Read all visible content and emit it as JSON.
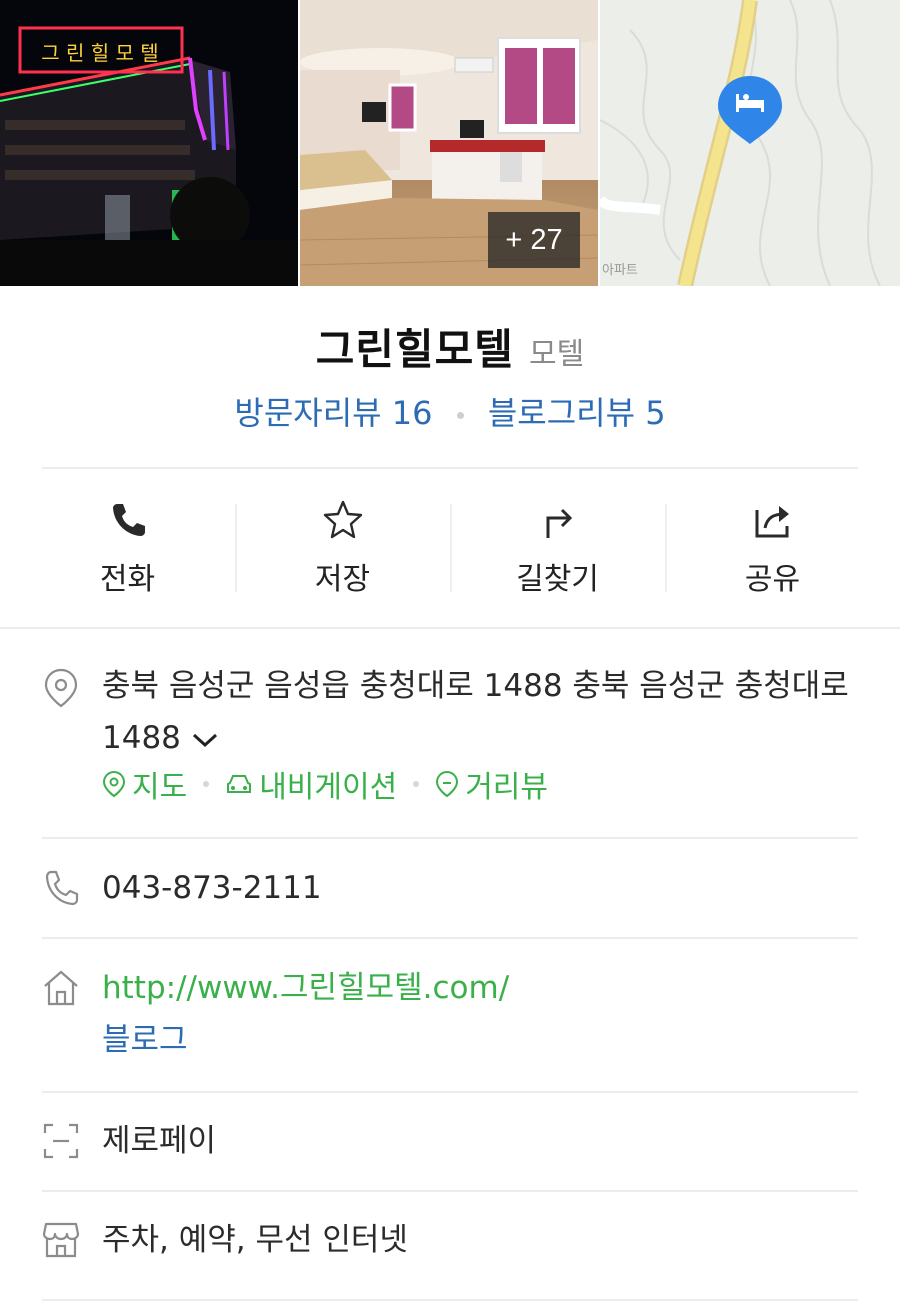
{
  "gallery": {
    "more_count": "+ 27",
    "sign_text": "그 린 힐 모 텔"
  },
  "place": {
    "name": "그린힐모텔",
    "category": "모텔",
    "visitor_reviews": "방문자리뷰 16",
    "blog_reviews": "블로그리뷰 5"
  },
  "actions": {
    "call": "전화",
    "save": "저장",
    "directions": "길찾기",
    "share": "공유"
  },
  "map_label": "아파트",
  "info": {
    "address": "충북 음성군 음성읍 충청대로 1488 충북 음성군 충청대로 1488",
    "map_link": "지도",
    "navigation_link": "내비게이션",
    "streetview_link": "거리뷰",
    "phone": "043-873-2111",
    "website": "http://www.그린힐모텔.com/",
    "blog": "블로그",
    "payment": "제로페이",
    "amenities": "주차, 예약, 무선 인터넷"
  },
  "colors": {
    "link_blue": "#2d6cb5",
    "link_green": "#3ab04b",
    "map_pin": "#2f86e8"
  }
}
